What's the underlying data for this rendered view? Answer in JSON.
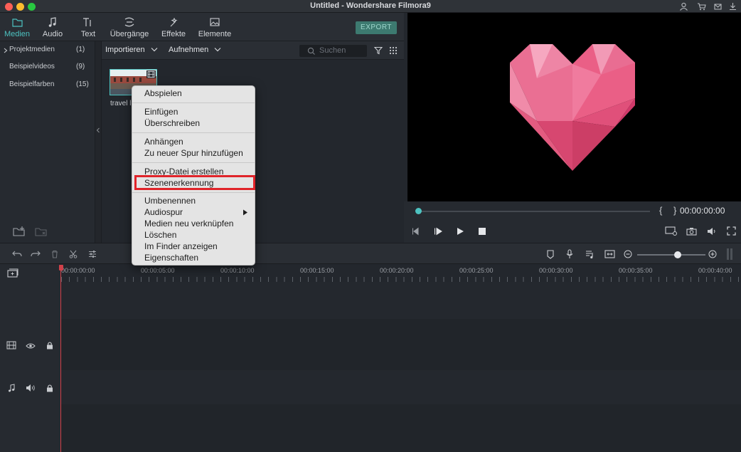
{
  "window": {
    "title": "Untitled - Wondershare Filmora9"
  },
  "toolbar": {
    "tabs": [
      {
        "label": "Medien",
        "icon": "folder-icon"
      },
      {
        "label": "Audio",
        "icon": "music-note-icon"
      },
      {
        "label": "Text",
        "icon": "text-icon"
      },
      {
        "label": "Übergänge",
        "icon": "transition-icon"
      },
      {
        "label": "Effekte",
        "icon": "effects-icon"
      },
      {
        "label": "Elemente",
        "icon": "image-icon"
      }
    ],
    "export_label": "EXPORT"
  },
  "sidebar": {
    "items": [
      {
        "label": "Projektmedien",
        "count": "(1)"
      },
      {
        "label": "Beispielvideos",
        "count": "(9)"
      },
      {
        "label": "Beispielfarben",
        "count": "(15)"
      }
    ]
  },
  "mediabar": {
    "import_label": "Importieren",
    "record_label": "Aufnehmen",
    "search_placeholder": "Suchen"
  },
  "media": {
    "thumb_label": "travel l"
  },
  "preview": {
    "timecode": "00:00:00:00",
    "braces": "{ }"
  },
  "ruler": {
    "ticks": [
      "00:00:00:00",
      "00:00:05:00",
      "00:00:10:00",
      "00:00:15:00",
      "00:00:20:00",
      "00:00:25:00",
      "00:00:30:00",
      "00:00:35:00",
      "00:00:40:00"
    ]
  },
  "context_menu": {
    "items": [
      "Abspielen",
      "Einfügen",
      "Überschreiben",
      "Anhängen",
      "Zu neuer Spur hinzufügen",
      "Proxy-Datei erstellen",
      "Szenenerkennung",
      "Umbenennen",
      "Audiospur",
      "Medien neu verknüpfen",
      "Löschen",
      "Im Finder anzeigen",
      "Eigenschaften"
    ],
    "highlighted": "Szenenerkennung"
  },
  "colors": {
    "accent": "#4dc2c0",
    "highlight_box": "#e0242a",
    "playhead": "#d1414a"
  }
}
